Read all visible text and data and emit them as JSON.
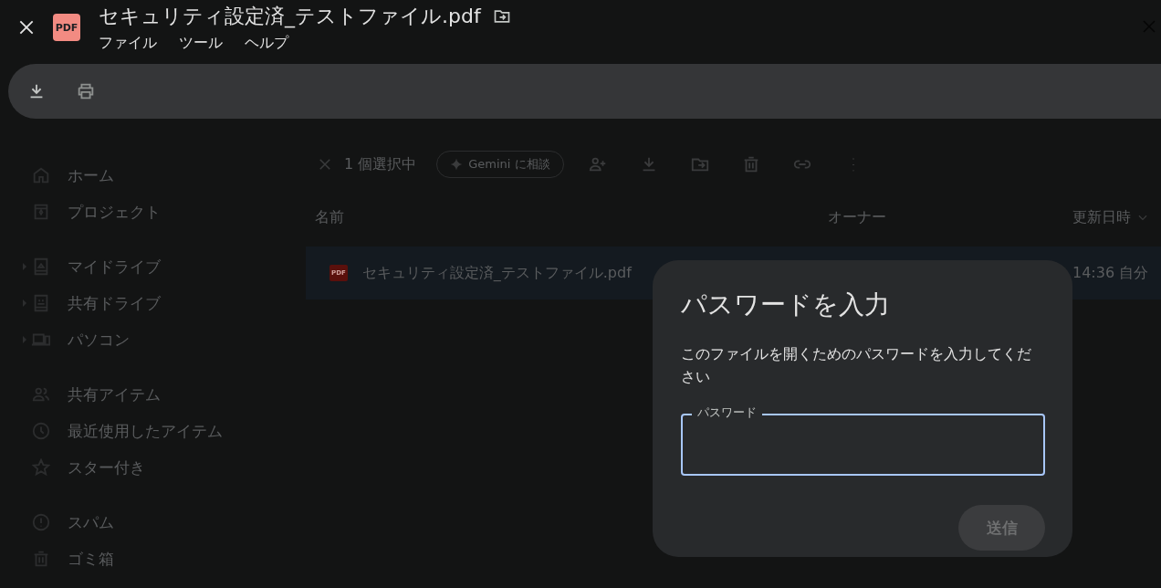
{
  "viewer": {
    "title": "セキュリティ設定済_テストファイル.pdf",
    "file_badge": "PDF",
    "menus": [
      "ファイル",
      "ツール",
      "ヘルプ"
    ]
  },
  "sidebar": {
    "groups": [
      [
        {
          "label": "ホーム",
          "expandable": false
        },
        {
          "label": "プロジェクト",
          "expandable": false
        }
      ],
      [
        {
          "label": "マイドライブ",
          "expandable": true
        },
        {
          "label": "共有ドライブ",
          "expandable": true
        },
        {
          "label": "パソコン",
          "expandable": true
        }
      ],
      [
        {
          "label": "共有アイテム",
          "expandable": false
        },
        {
          "label": "最近使用したアイテム",
          "expandable": false
        },
        {
          "label": "スター付き",
          "expandable": false
        }
      ],
      [
        {
          "label": "スパム",
          "expandable": false
        },
        {
          "label": "ゴミ箱",
          "expandable": false
        }
      ]
    ]
  },
  "selection_bar": {
    "count": "1 個選択中",
    "ask_chip": "Gemini に相談"
  },
  "table": {
    "columns": [
      "名前",
      "オーナー",
      "更新日時"
    ],
    "rows": [
      {
        "badge": "PDF",
        "name": "セキュリティ設定済_テストファイル.pdf",
        "modified": "14:36 自分",
        "selected": true
      }
    ]
  },
  "dialog": {
    "title": "パスワードを入力",
    "message": "このファイルを開くためのパスワードを入力してください",
    "field": {
      "label": "パスワード"
    },
    "submit": {
      "label": "送信",
      "disabled": true
    }
  }
}
